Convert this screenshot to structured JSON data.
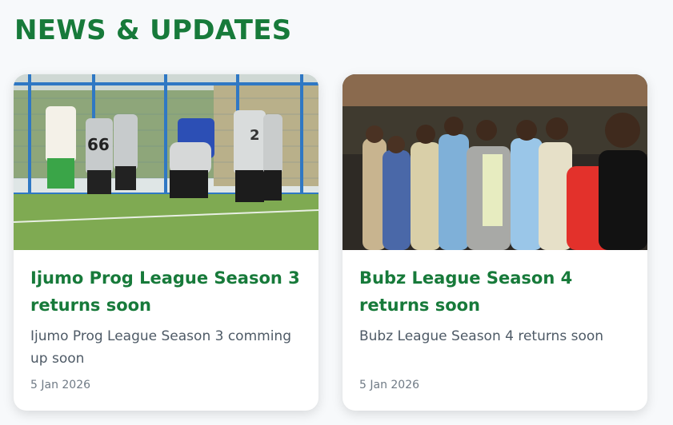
{
  "section": {
    "title": "NEWS & UPDATES"
  },
  "cards": [
    {
      "title": "Ijumo Prog League Season 3 returns soon",
      "excerpt": "Ijumo Prog League Season 3 comming up soon",
      "date": "5 Jan 2026",
      "jersey_numbers": [
        "66",
        "2"
      ]
    },
    {
      "title": "Bubz League Season 4 returns soon",
      "excerpt": "Bubz League Season 4 returns soon",
      "date": "5 Jan 2026"
    }
  ],
  "colors": {
    "accent_green": "#177a3a",
    "text_gray": "#4e5a66",
    "card_bg": "#ffffff",
    "page_bg": "#f7f9fb"
  }
}
